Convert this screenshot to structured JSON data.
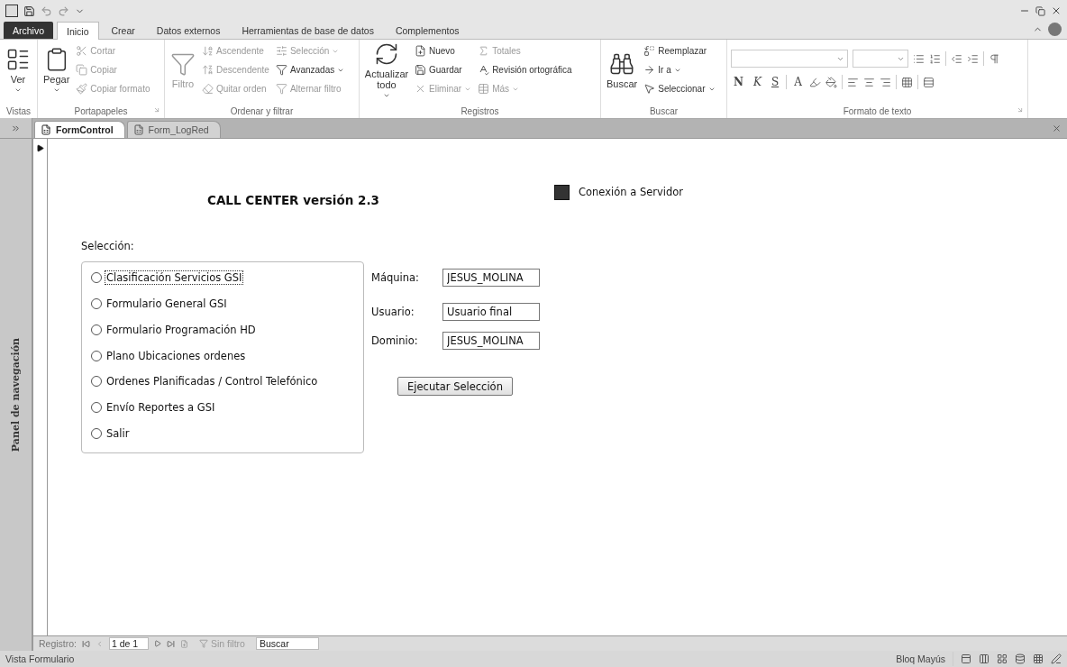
{
  "ribbon_tabs": [
    {
      "label": "Archivo",
      "kind": "file",
      "selected": false
    },
    {
      "label": "Inicio",
      "kind": "tab",
      "selected": true
    },
    {
      "label": "Crear",
      "kind": "tab",
      "selected": false
    },
    {
      "label": "Datos externos",
      "kind": "tab",
      "selected": false
    },
    {
      "label": "Herramientas de base de datos",
      "kind": "tab",
      "selected": false
    },
    {
      "label": "Complementos",
      "kind": "tab",
      "selected": false
    }
  ],
  "ribbon_groups": [
    {
      "label": "Vistas",
      "launcher": false,
      "kind": "commands",
      "items": [
        {
          "label": "Ver",
          "kind": "large",
          "disabled": false,
          "dropdown": true
        }
      ]
    },
    {
      "label": "Portapapeles",
      "launcher": true,
      "kind": "commands",
      "items": [
        {
          "label": "Pegar",
          "kind": "large",
          "disabled": false,
          "dropdown": true
        },
        {
          "label": "Cortar",
          "kind": "small",
          "disabled": true,
          "dropdown": false
        },
        {
          "label": "Copiar",
          "kind": "small",
          "disabled": true,
          "dropdown": false
        },
        {
          "label": "Copiar formato",
          "kind": "small",
          "disabled": true,
          "dropdown": false
        }
      ]
    },
    {
      "label": "Ordenar y filtrar",
      "launcher": false,
      "kind": "commands",
      "items": [
        {
          "label": "Filtro",
          "kind": "large",
          "disabled": true,
          "dropdown": false
        },
        {
          "label": "Ascendente",
          "kind": "small",
          "disabled": true,
          "dropdown": false
        },
        {
          "label": "Descendente",
          "kind": "small",
          "disabled": true,
          "dropdown": false
        },
        {
          "label": "Quitar orden",
          "kind": "small",
          "disabled": true,
          "dropdown": false
        },
        {
          "label": "Selección",
          "kind": "small",
          "disabled": true,
          "dropdown": true
        },
        {
          "label": "Avanzadas",
          "kind": "small",
          "disabled": false,
          "dropdown": true
        },
        {
          "label": "Alternar filtro",
          "kind": "small",
          "disabled": true,
          "dropdown": false
        }
      ]
    },
    {
      "label": "Registros",
      "launcher": false,
      "kind": "commands",
      "items": [
        {
          "label": "Actualizar todo",
          "kind": "large",
          "disabled": false,
          "dropdown": true
        },
        {
          "label": "Nuevo",
          "kind": "small",
          "disabled": false,
          "dropdown": false
        },
        {
          "label": "Guardar",
          "kind": "small",
          "disabled": false,
          "dropdown": false
        },
        {
          "label": "Eliminar",
          "kind": "small",
          "disabled": true,
          "dropdown": true
        },
        {
          "label": "Totales",
          "kind": "small",
          "disabled": true,
          "dropdown": false
        },
        {
          "label": "Revisión ortográfica",
          "kind": "small",
          "disabled": false,
          "dropdown": false
        },
        {
          "label": "Más",
          "kind": "small",
          "disabled": true,
          "dropdown": true
        }
      ]
    },
    {
      "label": "Buscar",
      "launcher": false,
      "kind": "commands",
      "items": [
        {
          "label": "Buscar",
          "kind": "large",
          "disabled": false,
          "dropdown": false
        },
        {
          "label": "Reemplazar",
          "kind": "small",
          "disabled": false,
          "dropdown": false
        },
        {
          "label": "Ir a",
          "kind": "small",
          "disabled": false,
          "dropdown": true
        },
        {
          "label": "Seleccionar",
          "kind": "small",
          "disabled": false,
          "dropdown": true
        }
      ]
    },
    {
      "label": "Formato de texto",
      "launcher": true,
      "kind": "format",
      "letters": [
        "N",
        "K",
        "S",
        "A"
      ]
    }
  ],
  "document_tabs": [
    {
      "label": "FormControl",
      "selected": true
    },
    {
      "label": "Form_LogRed",
      "selected": false
    }
  ],
  "navigation_pane": {
    "label": "Panel de navegación"
  },
  "form": {
    "title": "CALL CENTER versión 2.3",
    "connection": {
      "label": "Conexión a Servidor"
    },
    "selection_label": "Selección:",
    "options": [
      {
        "label": "Clasificación Servicios GSI",
        "selected": false,
        "focused": true
      },
      {
        "label": "Formulario General GSI",
        "selected": false,
        "focused": false
      },
      {
        "label": "Formulario Programación HD",
        "selected": false,
        "focused": false
      },
      {
        "label": "Plano Ubicaciones ordenes",
        "selected": false,
        "focused": false
      },
      {
        "label": "Ordenes Planificadas / Control Telefónico",
        "selected": false,
        "focused": false
      },
      {
        "label": "Envío Reportes a GSI",
        "selected": false,
        "focused": false
      },
      {
        "label": "Salir",
        "selected": false,
        "focused": false
      }
    ],
    "fields": [
      {
        "label": "Máquina:",
        "value": "JESUS_MOLINA"
      },
      {
        "label": "Usuario:",
        "value": "Usuario final"
      },
      {
        "label": "Dominio:",
        "value": "JESUS_MOLINA"
      }
    ],
    "run_button": "Ejecutar Selección"
  },
  "record_navigation": {
    "label": "Registro:",
    "position": "1 de 1",
    "filter": "Sin filtro",
    "search_placeholder": "Buscar"
  },
  "status_bar": {
    "view": "Vista Formulario",
    "caps_lock": "Bloq Mayús"
  }
}
